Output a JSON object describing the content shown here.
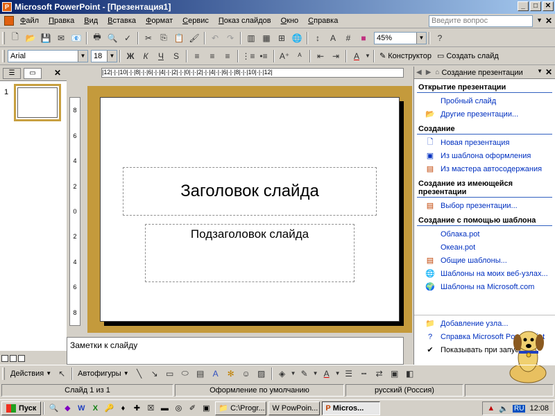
{
  "window": {
    "title": "Microsoft PowerPoint - [Презентация1]",
    "minimize": "_",
    "maximize": "□",
    "close": "✕"
  },
  "menu": {
    "items": [
      "Файл",
      "Правка",
      "Вид",
      "Вставка",
      "Формат",
      "Сервис",
      "Показ слайдов",
      "Окно",
      "Справка"
    ],
    "ask_placeholder": "Введите вопрос"
  },
  "standard_toolbar": {
    "zoom": "45%"
  },
  "format_toolbar": {
    "font": "Arial",
    "size": "18",
    "bold": "Ж",
    "italic": "К",
    "underline": "Ч",
    "shadow": "S",
    "designer": "Конструктор",
    "new_slide": "Создать слайд"
  },
  "slide": {
    "number": "1",
    "title_placeholder": "Заголовок слайда",
    "subtitle_placeholder": "Подзаголовок слайда"
  },
  "ruler": {
    "h": "|12|·|·|10|·|·|8|·|·|6|·|·|4|·|·|2|·|·|0|·|·|2|·|·|4|·|·|6|·|·|8|·|·|10|·|·|12|",
    "v": [
      "8",
      "6",
      "4",
      "2",
      "0",
      "2",
      "4",
      "6",
      "8"
    ]
  },
  "notes": {
    "placeholder": "Заметки к слайду"
  },
  "task_pane": {
    "title": "Создание презентации",
    "sections": [
      {
        "title": "Открытие презентации",
        "links": [
          {
            "label": "Пробный слайд",
            "icon": ""
          },
          {
            "label": "Другие презентации...",
            "icon": "folder-icon"
          }
        ]
      },
      {
        "title": "Создание",
        "links": [
          {
            "label": "Новая презентация",
            "icon": "new-doc-icon"
          },
          {
            "label": "Из шаблона оформления",
            "icon": "template-icon"
          },
          {
            "label": "Из мастера автосодержания",
            "icon": "wizard-icon"
          }
        ]
      },
      {
        "title": "Создание из имеющейся презентации",
        "links": [
          {
            "label": "Выбор презентации...",
            "icon": "choose-pres-icon"
          }
        ]
      },
      {
        "title": "Создание с помощью шаблона",
        "links": [
          {
            "label": "Облака.pot",
            "icon": ""
          },
          {
            "label": "Океан.pot",
            "icon": ""
          },
          {
            "label": "Общие шаблоны...",
            "icon": "templates-icon"
          },
          {
            "label": "Шаблоны на моих веб-узлах...",
            "icon": "web-templates-icon"
          },
          {
            "label": "Шаблоны на Microsoft.com",
            "icon": "globe-icon"
          }
        ]
      }
    ],
    "bottom": {
      "add_node": "Добавление узла...",
      "help": "Справка Microsoft PowerPoint",
      "show_at_startup": "Показывать при запуске"
    }
  },
  "draw_toolbar": {
    "actions": "Действия",
    "autoshapes": "Автофигуры"
  },
  "status_bar": {
    "slide": "Слайд 1 из 1",
    "design": "Оформление по умолчанию",
    "language": "русский (Россия)"
  },
  "taskbar": {
    "start": "Пуск",
    "tasks": [
      "C:\\Progr...",
      "PowPoin...",
      "Micros..."
    ],
    "lang": "RU",
    "time": "12:08"
  }
}
